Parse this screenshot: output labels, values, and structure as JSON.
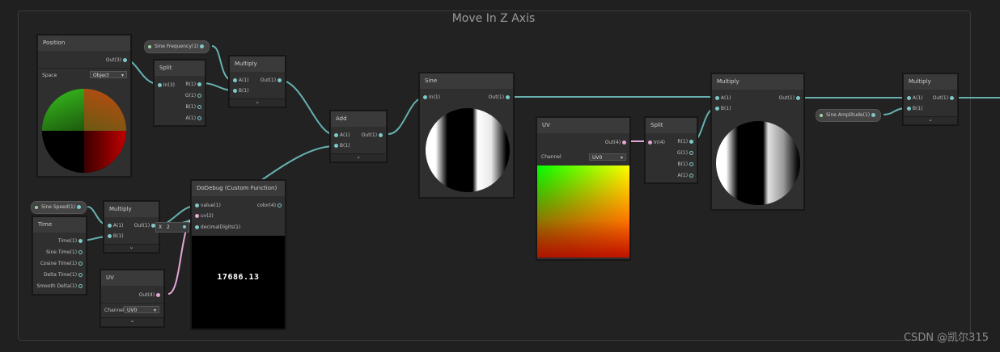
{
  "group": {
    "title": "Move In Z Axis"
  },
  "colors": {
    "wire": "#67b0b0",
    "wire_uv": "#e5a6d6"
  },
  "nodes": {
    "position": {
      "title": "Position",
      "out": "Out(3)",
      "space_label": "Space",
      "space_value": "Object"
    },
    "sine_frequency": {
      "label": "Sine Frequency(1)"
    },
    "split1": {
      "title": "Split",
      "in": "In(3)",
      "outs": [
        "R(1)",
        "G(1)",
        "B(1)",
        "A(1)"
      ]
    },
    "multiply1": {
      "title": "Multiply",
      "ins": [
        "A(1)",
        "B(1)"
      ],
      "out": "Out(1)"
    },
    "add": {
      "title": "Add",
      "ins": [
        "A(1)",
        "B(1)"
      ],
      "out": "Out(1)"
    },
    "sine": {
      "title": "Sine",
      "in": "In(1)",
      "out": "Out(1)"
    },
    "uv1": {
      "title": "UV",
      "out": "Out(4)",
      "channel_label": "Channel",
      "channel_value": "UV0"
    },
    "split2": {
      "title": "Split",
      "in": "In(4)",
      "outs": [
        "R(1)",
        "G(1)",
        "B(1)",
        "A(1)"
      ]
    },
    "multiply3": {
      "title": "Multiply",
      "ins": [
        "A(1)",
        "B(1)"
      ],
      "out": "Out(1)"
    },
    "sine_amplitude": {
      "label": "Sine Amplitude(1)"
    },
    "multiply4": {
      "title": "Multiply",
      "ins": [
        "A(1)",
        "B(1)"
      ],
      "out": "Out(1)"
    },
    "sine_speed": {
      "label": "Sine Speed(1)"
    },
    "time": {
      "title": "Time",
      "outs": [
        "Time(1)",
        "Sine Time(1)",
        "Cosine Time(1)",
        "Delta Time(1)",
        "Smooth Delta(1)"
      ]
    },
    "multiply2": {
      "title": "Multiply",
      "ins": [
        "A(1)",
        "B(1)"
      ],
      "out": "Out(1)"
    },
    "debug": {
      "title": "DoDebug (Custom Function)",
      "ins": [
        "value(1)",
        "uv(2)",
        "decimalDigits(1)"
      ],
      "out": "color(4)",
      "preview_text": "17686.13",
      "inline_x": "X",
      "inline_value": "2"
    },
    "uv2": {
      "title": "UV",
      "out": "Out(4)",
      "channel_label": "Channel",
      "channel_value": "UV0"
    }
  },
  "watermark": "CSDN @凯尔315"
}
